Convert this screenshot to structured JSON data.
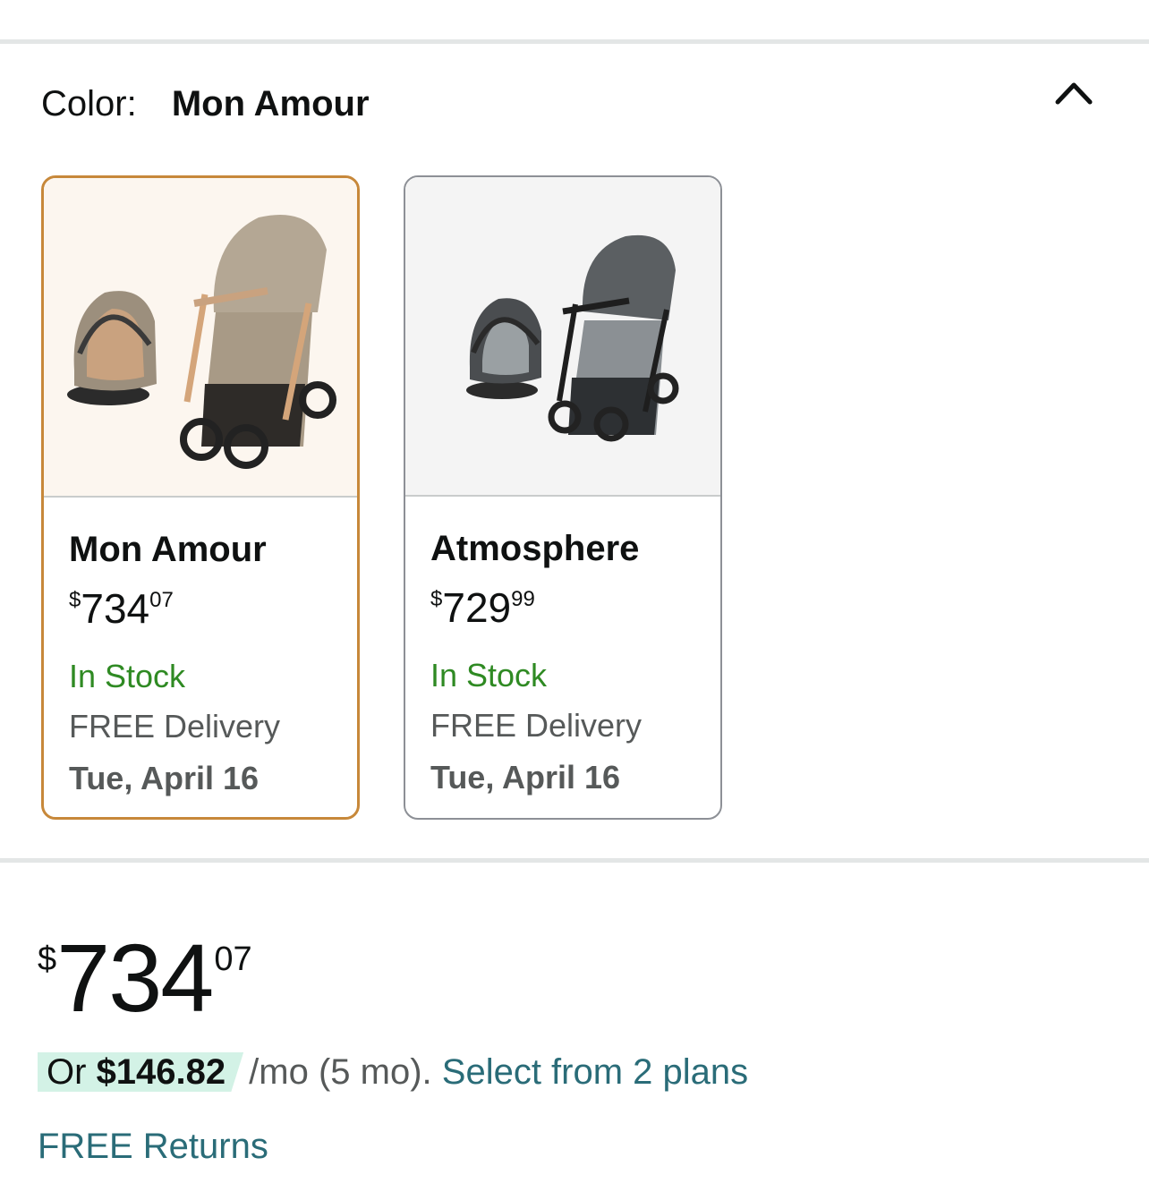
{
  "color_selector": {
    "label": "Color:",
    "selected": "Mon Amour"
  },
  "options": [
    {
      "name": "Mon Amour",
      "price_symbol": "$",
      "price_whole": "734",
      "price_fraction": "07",
      "stock": "In Stock",
      "delivery": "FREE Delivery",
      "date": "Tue, April 16",
      "selected": true
    },
    {
      "name": "Atmosphere",
      "price_symbol": "$",
      "price_whole": "729",
      "price_fraction": "99",
      "stock": "In Stock",
      "delivery": "FREE Delivery",
      "date": "Tue, April 16",
      "selected": false
    }
  ],
  "price": {
    "symbol": "$",
    "whole": "734",
    "fraction": "07"
  },
  "installment": {
    "prefix": "Or",
    "amount": "$146.82",
    "terms": "/mo (5 mo).",
    "plans_link": "Select from 2 plans"
  },
  "returns": "FREE Returns",
  "colors": {
    "selected_border": "#c7883a",
    "in_stock": "#2f8a23",
    "link": "#2a6c78",
    "installment_highlight": "#d3f2e6"
  },
  "icons": {
    "collapse": "chevron-up-icon"
  }
}
